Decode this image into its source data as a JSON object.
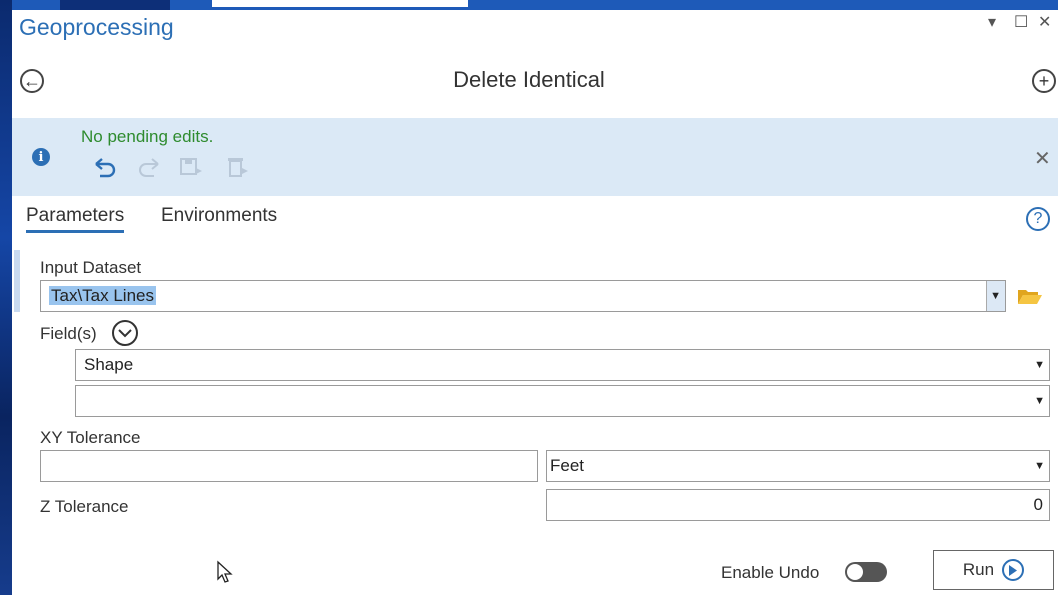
{
  "window": {
    "title": "Geoprocessing",
    "pin_icon": "▾",
    "maximize_icon": "☐",
    "close_icon": "✕"
  },
  "header": {
    "back_icon": "←",
    "tool_title": "Delete Identical",
    "add_icon": "+"
  },
  "info_bar": {
    "info_icon": "i",
    "message": "No pending edits.",
    "close_icon": "✕"
  },
  "tabs": [
    {
      "label": "Parameters",
      "active": true
    },
    {
      "label": "Environments",
      "active": false
    }
  ],
  "help_icon": "?",
  "params": {
    "input_dataset": {
      "label": "Input Dataset",
      "value": "Tax\\Tax Lines"
    },
    "fields": {
      "label": "Field(s)",
      "values": [
        "Shape",
        ""
      ]
    },
    "xy_tolerance": {
      "label": "XY Tolerance",
      "value": "",
      "unit": "Feet"
    },
    "z_tolerance": {
      "label": "Z Tolerance",
      "value": "0"
    }
  },
  "footer": {
    "enable_undo_label": "Enable Undo",
    "enable_undo_on": false,
    "run_label": "Run"
  },
  "colors": {
    "accent": "#2c6fb5",
    "info_bar_bg": "#dbe9f6",
    "pending_text": "#2e8b2e"
  }
}
